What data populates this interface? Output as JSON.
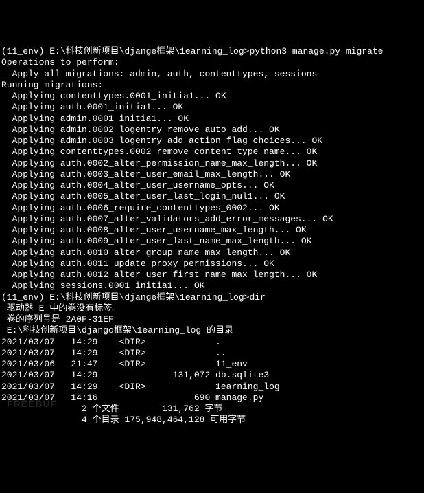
{
  "prompt1": {
    "prefix": "(11_env) E:\\科技创新项目\\djange框架\\1earning_log>",
    "command": "python3 manage.py migrate"
  },
  "header1": "Operations to perform:",
  "applyAll": "Apply all migrations: admin, auth, contenttypes, sessions",
  "header2": "Running migrations:",
  "migrations": [
    "Applying contenttypes.0001_initia1... OK",
    "Applying auth.0001_initia1... OK",
    "Applying admin.0001_initia1... OK",
    "Applying admin.0002_logentry_remove_auto_add... OK",
    "Applying admin.0003_logentry_add_action_flag_choices... OK",
    "Applying contenttypes.0002_remove_content_type_name... OK",
    "Applying auth.0002_alter_permission_name_max_length... OK",
    "Applying auth.0003_alter_user_email_max_length... OK",
    "Applying auth.0004_alter_user_username_opts... OK",
    "Applying auth.0005_alter_user_last_login_nul1... OK",
    "Applying auth.0006_require_contenttypes_0002... OK",
    "Applying auth.0007_alter_validators_add_error_messages... OK",
    "Applying auth.0008_alter_user_username_max_length... OK",
    "Applying auth.0009_alter_user_last_name_max_length... OK",
    "Applying auth.0010_alter_group_name_max_length... OK",
    "Applying auth.0011_update_proxy_permissions... OK",
    "Applying auth.0012_alter_user_first_name_max_length... OK",
    "Applying sessions.0001_initia1... OK"
  ],
  "prompt2": {
    "prefix": "(11_env) E:\\科技创新项目\\djange框架\\1earning_log>",
    "command": "dir"
  },
  "driveInfo": {
    "noLabel": " 驱动器 E 中的卷没有标签。",
    "serial": " 卷的序列号是 2A0F-31EF"
  },
  "dirHeader": " E:\\科技创新项目\\django框架\\1earning_log 的目录",
  "entries": [
    {
      "date": "2021/03/07",
      "time": "14:29",
      "type": "<DIR>",
      "size": "",
      "name": "."
    },
    {
      "date": "2021/03/07",
      "time": "14:29",
      "type": "<DIR>",
      "size": "",
      "name": ".."
    },
    {
      "date": "2021/03/06",
      "time": "21:47",
      "type": "<DIR>",
      "size": "",
      "name": "11_env"
    },
    {
      "date": "2021/03/07",
      "time": "14:29",
      "type": "",
      "size": "131,072",
      "name": "db.sqlite3"
    },
    {
      "date": "2021/03/07",
      "time": "14:29",
      "type": "<DIR>",
      "size": "",
      "name": "1earning_log"
    },
    {
      "date": "2021/03/07",
      "time": "14:16",
      "type": "",
      "size": "690",
      "name": "manage.py"
    }
  ],
  "summary": {
    "files": "               2 个文件        131,762 字节",
    "dirs": "               4 个目录 175,948,464,128 可用字节"
  },
  "watermark": "FREEBUF"
}
